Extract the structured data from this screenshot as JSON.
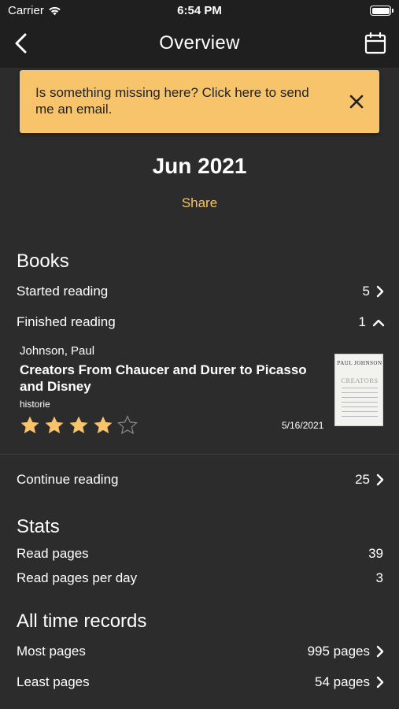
{
  "status": {
    "carrier": "Carrier",
    "time": "6:54 PM"
  },
  "nav": {
    "title": "Overview"
  },
  "banner": {
    "text": "Is something missing here? Click here to send me an email."
  },
  "period": {
    "month": "Jun 2021",
    "share": "Share"
  },
  "books": {
    "title": "Books",
    "started": {
      "label": "Started reading",
      "value": "5"
    },
    "finished": {
      "label": "Finished reading",
      "value": "1"
    },
    "finished_items": [
      {
        "author": "Johnson, Paul",
        "title": "Creators From Chaucer and Durer to Picasso and Disney",
        "genre": "historie",
        "rating": 4,
        "rating_max": 5,
        "date": "5/16/2021",
        "cover_author": "PAUL JOHNSON",
        "cover_title": "CREATORS"
      }
    ],
    "continue": {
      "label": "Continue reading",
      "value": "25"
    }
  },
  "stats": {
    "title": "Stats",
    "read_pages": {
      "label": "Read pages",
      "value": "39"
    },
    "per_day": {
      "label": "Read pages per day",
      "value": "3"
    }
  },
  "records": {
    "title": "All time records",
    "most": {
      "label": "Most pages",
      "value": "995 pages"
    },
    "least": {
      "label": "Least pages",
      "value": "54 pages"
    }
  },
  "colors": {
    "accent": "#f7c46b",
    "background": "#2c2c2c",
    "bar": "#1f1f1f"
  }
}
